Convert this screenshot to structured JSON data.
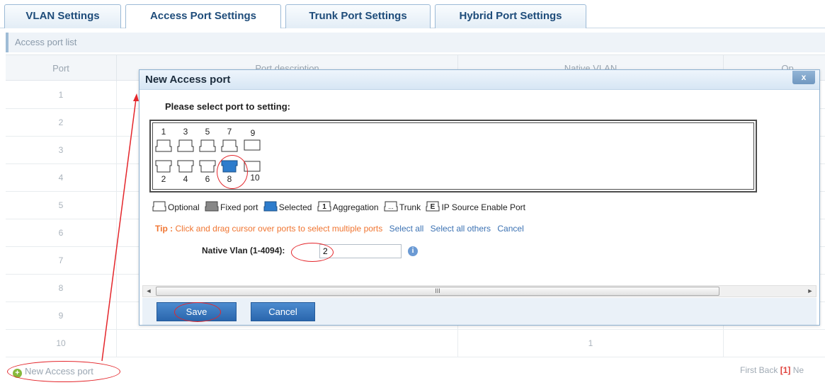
{
  "tabs": [
    {
      "label": "VLAN Settings"
    },
    {
      "label": "Access Port Settings"
    },
    {
      "label": "Trunk Port Settings"
    },
    {
      "label": "Hybrid Port Settings"
    }
  ],
  "section": {
    "title": "Access port list"
  },
  "table": {
    "headers": [
      "Port",
      "Port description",
      "Native VLAN",
      "Op"
    ],
    "rows": [
      {
        "port": "1",
        "native_vlan": ""
      },
      {
        "port": "2",
        "native_vlan": ""
      },
      {
        "port": "3",
        "native_vlan": ""
      },
      {
        "port": "4",
        "native_vlan": ""
      },
      {
        "port": "5",
        "native_vlan": ""
      },
      {
        "port": "6",
        "native_vlan": ""
      },
      {
        "port": "7",
        "native_vlan": ""
      },
      {
        "port": "8",
        "native_vlan": ""
      },
      {
        "port": "9",
        "native_vlan": ""
      },
      {
        "port": "10",
        "native_vlan": "1"
      }
    ]
  },
  "new_link": {
    "label": "New Access port",
    "icon": "plus-circle-icon"
  },
  "pager": {
    "first": "First",
    "back": "Back",
    "current": "[1]",
    "next": "Ne"
  },
  "dialog": {
    "title": "New Access port",
    "close": "x",
    "prompt": "Please select port to setting:",
    "ports": {
      "top": [
        "1",
        "3",
        "5",
        "7",
        "9"
      ],
      "bottom": [
        "2",
        "4",
        "6",
        "8",
        "10"
      ],
      "selected": "8"
    },
    "legend": [
      {
        "label": "Optional",
        "icon": "port-optional-icon"
      },
      {
        "label": "Fixed port",
        "icon": "port-fixed-icon"
      },
      {
        "label": "Selected",
        "icon": "port-selected-icon"
      },
      {
        "label": "Aggregation",
        "icon": "port-aggregation-icon",
        "glyph": "1"
      },
      {
        "label": "Trunk",
        "icon": "port-trunk-icon",
        "glyph": "..."
      },
      {
        "label": "IP Source Enable Port",
        "icon": "port-ipsource-icon",
        "glyph": "E"
      }
    ],
    "tip": {
      "label": "Tip :",
      "text": "Click and drag cursor over ports to select multiple ports",
      "links": [
        "Select all",
        "Select all others",
        "Cancel"
      ]
    },
    "native_vlan": {
      "label": "Native Vlan (1-4094):",
      "value": "2"
    },
    "scrollbar": {
      "left": "◄",
      "grip": "III",
      "right": "►"
    },
    "buttons": {
      "save": "Save",
      "cancel": "Cancel"
    }
  },
  "colors": {
    "tab_text": "#1e4c7a",
    "accent_blue": "#2a66ad",
    "tip_orange": "#f07531",
    "annotation_red": "#e4262b",
    "pager_current": "#e0433d"
  }
}
